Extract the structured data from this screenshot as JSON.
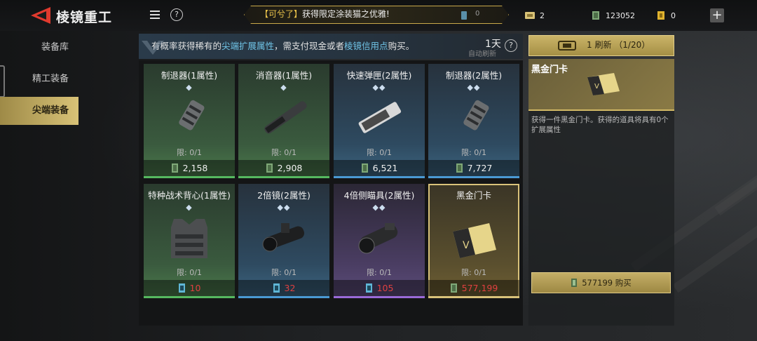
{
  "header": {
    "title": "棱镜重工",
    "back_icon": "back-arrow-icon",
    "notice_tag": "【可兮了】",
    "notice_text": "获得限定涂装猫之优雅!",
    "notice_count": "0",
    "currencies": [
      {
        "icon": "ticket-icon",
        "value": "2"
      },
      {
        "icon": "cash-icon",
        "value": "123052"
      },
      {
        "icon": "card-icon",
        "value": "0"
      }
    ],
    "add_label": "+"
  },
  "sidebar": {
    "items": [
      {
        "label": "装备库",
        "active": false
      },
      {
        "label": "精工装备",
        "active": false
      },
      {
        "label": "尖端装备",
        "active": true
      }
    ]
  },
  "info": {
    "prefix": "有概率获得稀有的",
    "hl1": "尖端扩展属性",
    "mid": "，需支付现金或者",
    "hl2": "棱镜信用点",
    "suffix": "购买。",
    "refresh_time": "1天",
    "refresh_auto": "自动刷新",
    "help": "?"
  },
  "items": [
    {
      "name": "制退器(1属性)",
      "diamonds": "◆",
      "limit": "限: 0/1",
      "price": "2,158",
      "currency": "cash",
      "rarity": "green",
      "art": "muzzle-brake-icon"
    },
    {
      "name": "消音器(1属性)",
      "diamonds": "◆",
      "limit": "限: 0/1",
      "price": "2,908",
      "currency": "cash",
      "rarity": "green",
      "art": "suppressor-icon"
    },
    {
      "name": "快速弹匣(2属性)",
      "diamonds": "◆◆",
      "limit": "限: 0/1",
      "price": "6,521",
      "currency": "cash",
      "rarity": "blue",
      "art": "magazine-icon"
    },
    {
      "name": "制退器(2属性)",
      "diamonds": "◆◆",
      "limit": "限: 0/1",
      "price": "7,727",
      "currency": "cash",
      "rarity": "blue",
      "art": "muzzle-brake-icon"
    },
    {
      "name": "特种战术背心(1属性)",
      "diamonds": "◆",
      "limit": "限: 0/1",
      "price": "10",
      "currency": "credit",
      "rarity": "green",
      "art": "tactical-vest-icon"
    },
    {
      "name": "2倍镜(2属性)",
      "diamonds": "◆◆",
      "limit": "限: 0/1",
      "price": "32",
      "currency": "credit",
      "rarity": "blue",
      "art": "scope-2x-icon"
    },
    {
      "name": "4倍侧瞄具(2属性)",
      "diamonds": "◆◆",
      "limit": "限: 0/1",
      "price": "105",
      "currency": "credit",
      "rarity": "purple",
      "art": "scope-4x-icon"
    },
    {
      "name": "黑金门卡",
      "diamonds": "",
      "limit": "限: 0/1",
      "price": "577,199",
      "currency": "cash",
      "rarity": "gold",
      "art": "gold-card-icon"
    }
  ],
  "right_panel": {
    "refresh_label": "1 刷新 （1/20）",
    "item_name": "黑金门卡",
    "description": "获得一件黑金门卡。获得的道具将具有0个扩展属性",
    "buy_label": "577199 购买"
  },
  "colors": {
    "accent_gold": "#d9c27a",
    "price_red": "#e04040",
    "highlight_blue": "#6fc3e6"
  }
}
